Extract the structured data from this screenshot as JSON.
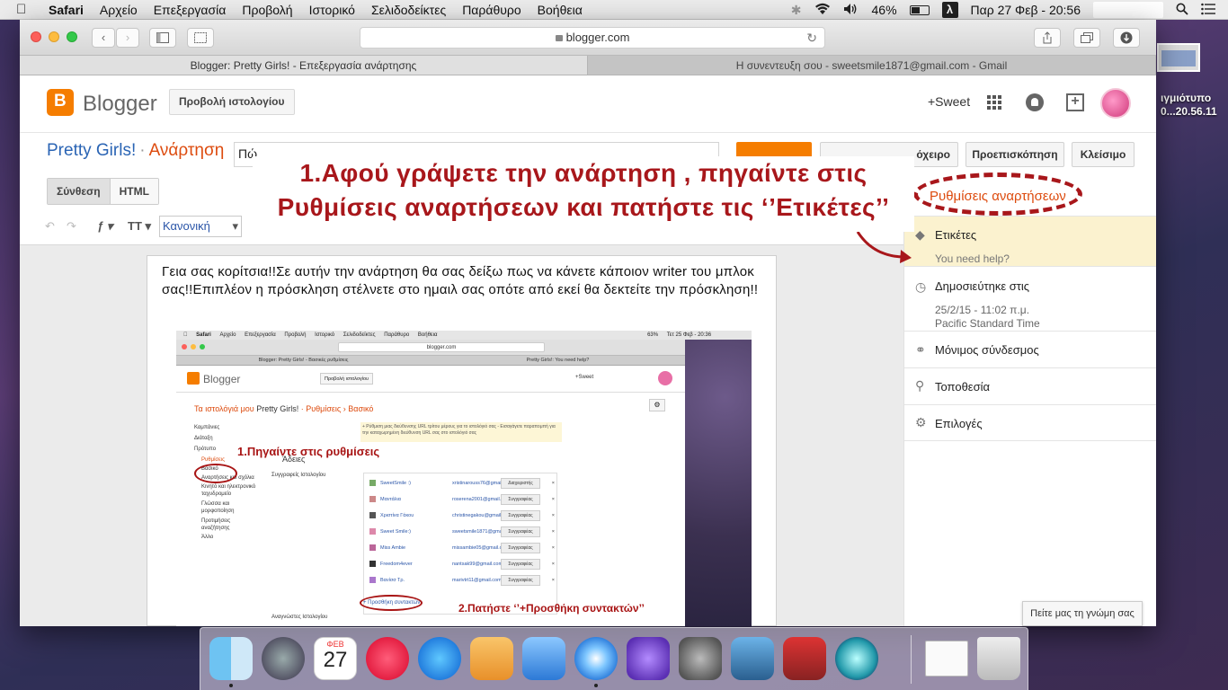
{
  "menubar": {
    "apple_icon": "apple-icon",
    "items": [
      "Safari",
      "Αρχείο",
      "Επεξεργασία",
      "Προβολή",
      "Ιστορικό",
      "Σελιδοδείκτες",
      "Παράθυρο",
      "Βοήθεια"
    ],
    "battery": "46%",
    "datetime": "Παρ 27 Φεβ - 20:56",
    "input_menu": "λ"
  },
  "safari": {
    "url": "blogger.com",
    "tabs": [
      "Blogger: Pretty Girls! - Επεξεργασία ανάρτησης",
      "Η συνεντευξη σου - sweetsmile1871@gmail.com - Gmail"
    ],
    "new_tab": "+"
  },
  "blogger": {
    "brand": "Blogger",
    "view_blog_button": "Προβολή ιστολογίου",
    "account": "+Sweet",
    "blog_name": "Pretty Girls!",
    "separator": "·",
    "section": "Ανάρτηση",
    "title_input_value": "Πώ",
    "draft_button": "όχειρο",
    "preview_button": "Προεπισκόπηση",
    "close_button": "Κλείσιμο"
  },
  "composer": {
    "mode_compose": "Σύνθεση",
    "mode_html": "HTML",
    "format_select": "Κανονική",
    "body_text": "Γεια σας κορίτσια!!Σε αυτήν την ανάρτηση θα σας δείξω πως να κάνετε κάποιον writer του μπλοκ σας!!Επιπλέον η πρόσκληση στέλνετε στο ημαιλ σας οπότε από εκεί θα δεκτείτε την πρόσκληση!!"
  },
  "embedded_screenshot": {
    "menubar_items": [
      "Safari",
      "Αρχείο",
      "Επεξεργασία",
      "Προβολή",
      "Ιστορικό",
      "Σελιδοδείκτες",
      "Παράθυρο",
      "Βοήθεια"
    ],
    "datetime": "Τετ 25 Φεβ - 20:36",
    "battery": "63%",
    "url": "blogger.com",
    "tabs": [
      "Blogger: Pretty Girls! - Βασικές ρυθμίσεις",
      "Pretty Girls!: You need help?"
    ],
    "brand": "Blogger",
    "view_blog": "Προβολή ιστολογίου",
    "account": "+Sweet",
    "crumb_my_blogs": "Τα ιστολόγιά μου",
    "crumb_blog": "Pretty Girls!",
    "crumb_settings": "Ρυθμίσεις",
    "crumb_basic": "Βασικό",
    "notice": "+ Ρύθμιση μιας διεύθυνσης URL τρίτου μέρους για το ιστολόγιό σας - Εισαγάγετε παραπομπή για την καταχωρημένη διεύθυνση URL σας στο ιστολόγιό σας",
    "sidebar": [
      "Καμπάνιες",
      "Διάταξη",
      "Πρότυπο",
      "Ρυθμίσεις",
      "Βασικό",
      "Αναρτήσεις και σχόλια",
      "Κινητό και ηλεκτρονικό ταχυδρομείο",
      "Γλώσσα και μορφοποίηση",
      "Προτιμήσεις αναζήτησης",
      "Άλλο"
    ],
    "permissions_heading": "Άδειες",
    "authors_label": "Συγγραφείς Ιστολογίου",
    "authors": [
      {
        "name": "SweetSmile :)",
        "email": "xristinarouss76@gmail.com",
        "role": "Διαχειριστής"
      },
      {
        "name": "Μαντάλια",
        "email": "roserena2001@gmail.com",
        "role": "Συγγραφέας"
      },
      {
        "name": "Χριστίνα Γάκου",
        "email": "christinegakou@gmail.com",
        "role": "Συγγραφέας"
      },
      {
        "name": "Sweet Smile:)",
        "email": "sweetsmile1871@gmail.com",
        "role": "Συγγραφέας"
      },
      {
        "name": "Miss Ambie",
        "email": "missambie05@gmail.com",
        "role": "Συγγραφέας"
      },
      {
        "name": "Freedom4ever",
        "email": "nantsak99@gmail.com",
        "role": "Συγγραφέας"
      },
      {
        "name": "Βανίσσ Τρ.",
        "email": "marivtrt11@gmail.com",
        "role": "Συγγραφέας"
      }
    ],
    "add_authors": "+ Προσθήκη συντακτών",
    "readers_label": "Αναγνώστες Ιστολογίου",
    "annotation_1": "1.Πηγαίντε στις ρυθμίσεις",
    "annotation_2": "2.Πατήστε ‘’+Προσθήκη συντακτών’’"
  },
  "settings_panel": {
    "title": "Ρυθμίσεις αναρτήσεων",
    "labels": "Ετικέτες",
    "labels_value": "You need help?",
    "published": "Δημοσιεύτηκε στις",
    "published_date": "25/2/15 - 11:02 π.μ.",
    "timezone": "Pacific Standard Time",
    "permalink": "Μόνιμος σύνδεσμος",
    "location": "Τοποθεσία",
    "options": "Επιλογές"
  },
  "annotation": {
    "line1": "1.Αφού γράψετε την ανάρτηση , πηγαίντε στις",
    "line2": "Ρυθμίσεις αναρτήσεων και πατήστε τις ‘’Ετικέτες’’",
    "color": "#a8171b"
  },
  "feedback_button": "Πείτε μας τη γνώμη σας",
  "desktop": {
    "file_label_1": "ιγμιότυπο",
    "file_label_2": "0...20.56.11"
  },
  "dock": {
    "calendar_month": "ΦΕΒ",
    "calendar_day": "27",
    "apps": [
      "finder-icon",
      "launchpad-icon",
      "calendar-icon",
      "itunes-icon",
      "app-store-icon",
      "pages-icon",
      "keynote-icon",
      "safari-icon",
      "imovie-icon",
      "system-preferences-icon",
      "iphoto-icon",
      "photo-booth-icon",
      "quicktime-icon",
      "downloads-stack-icon",
      "trash-icon"
    ]
  }
}
